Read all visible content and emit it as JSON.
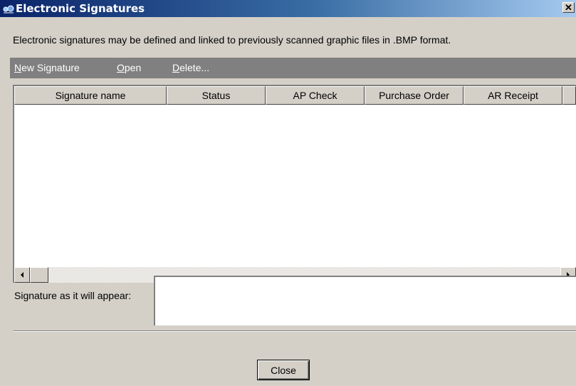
{
  "window": {
    "title": "Electronic Signatures",
    "close_glyph": "✕",
    "icon": "electronic-signatures-app-icon"
  },
  "description": "Electronic signatures may be defined and linked to previously scanned graphic files in .BMP format.",
  "menu": {
    "new_signature": {
      "mnemonic": "N",
      "rest": "ew Signature"
    },
    "open": {
      "mnemonic": "O",
      "rest": "pen"
    },
    "delete": {
      "mnemonic": "D",
      "rest": "elete..."
    }
  },
  "table": {
    "columns": [
      "Signature name",
      "Status",
      "AP Check",
      "Purchase Order",
      "AR Receipt",
      ""
    ],
    "rows": []
  },
  "scrollbar": {
    "left_icon": "scroll-left-arrow-icon",
    "right_icon": "scroll-right-arrow-icon"
  },
  "preview": {
    "label": "Signature as it will appear:"
  },
  "buttons": {
    "close": "Close"
  },
  "colors": {
    "titlebar_start": "#0a246a",
    "titlebar_end": "#a6caf0",
    "dialog_bg": "#d4d0c8",
    "menubar_bg": "#808080"
  }
}
